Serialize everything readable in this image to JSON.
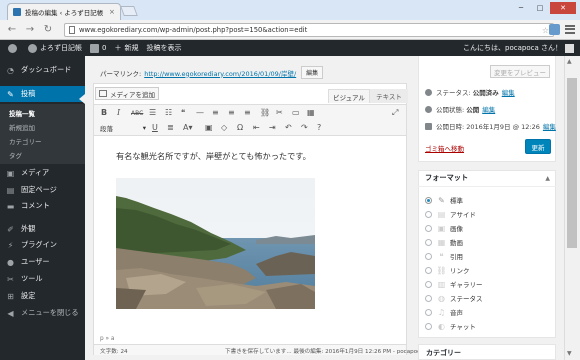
{
  "browser": {
    "tab_title": "投稿の編集 ‹ よろず日記帳",
    "tab_close": "×",
    "url": "www.egokorediary.com/wp-admin/post.php?post=150&action=edit",
    "window_buttons": [
      "─",
      "□",
      "✕"
    ]
  },
  "adminbar": {
    "site_name": "よろず日記帳",
    "comments_count": "0",
    "new_label": "新規",
    "view_post": "投稿を表示",
    "howdy": "こんにちは、pocapoca さん！"
  },
  "sidebar": {
    "items": [
      {
        "label": "ダッシュボード",
        "icon": "dashboard-icon"
      },
      {
        "label": "投稿",
        "icon": "pin-icon"
      },
      {
        "label": "メディア",
        "icon": "media-icon"
      },
      {
        "label": "固定ページ",
        "icon": "page-icon"
      },
      {
        "label": "コメント",
        "icon": "comment-icon"
      },
      {
        "label": "外観",
        "icon": "brush-icon"
      },
      {
        "label": "プラグイン",
        "icon": "plugin-icon"
      },
      {
        "label": "ユーザー",
        "icon": "user-icon"
      },
      {
        "label": "ツール",
        "icon": "wrench-icon"
      },
      {
        "label": "設定",
        "icon": "settings-icon"
      },
      {
        "label": "メニューを閉じる",
        "icon": "collapse-icon"
      }
    ],
    "submenu": [
      "投稿一覧",
      "新規追加",
      "カテゴリー",
      "タグ"
    ]
  },
  "editor": {
    "permalink_label": "パーマリンク:",
    "permalink_url": "http://www.egokorediary.com/2016/01/09/岸壁/",
    "permalink_edit": "編集",
    "add_media": "メディアを追加",
    "tab_visual": "ビジュアル",
    "tab_text": "テキスト",
    "format_select": "段落",
    "content_text": "有名な観光名所ですが、岸壁がとても怖かったです。",
    "path": "p » a",
    "word_count": "文字数: 24",
    "last_edit": "下書きを保存しています... 最後の編集: 2016年1月9日 12:26 PM - pocapoca"
  },
  "publish": {
    "preview": "変更をプレビュー",
    "status_label": "ステータス:",
    "status_value": "公開済み",
    "visibility_label": "公開状態:",
    "visibility_value": "公開",
    "date_label": "公開日時:",
    "date_value": "2016年1月9日 @ 12:26",
    "edit": "編集",
    "trash": "ゴミ箱へ移動",
    "update": "更新"
  },
  "format_box": {
    "title": "フォーマット",
    "options": [
      "標準",
      "アサイド",
      "画像",
      "動画",
      "引用",
      "リンク",
      "ギャラリー",
      "ステータス",
      "音声",
      "チャット"
    ],
    "selected": 0
  },
  "category_box": {
    "title": "カテゴリー"
  }
}
